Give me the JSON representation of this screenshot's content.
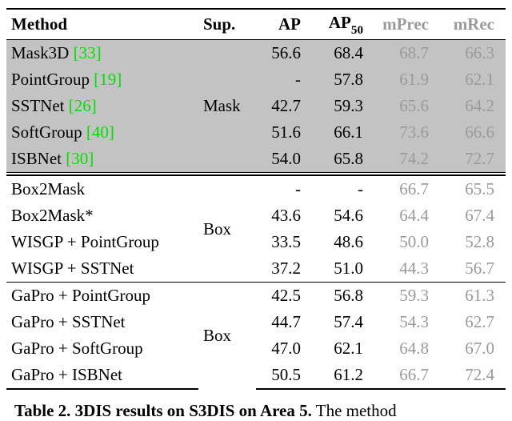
{
  "header": {
    "method": "Method",
    "sup": "Sup.",
    "ap": "AP",
    "ap50_pre": "AP",
    "ap50_sub": "50",
    "mprec": "mPrec",
    "mrec": "mRec"
  },
  "groups": [
    {
      "sup": "Mask",
      "shaded": true,
      "rows": [
        {
          "method": "Mask3D",
          "cite": "[33]",
          "ap": "56.6",
          "ap50": "68.4",
          "mprec": "68.7",
          "mrec": "66.3"
        },
        {
          "method": "PointGroup",
          "cite": "[19]",
          "ap": "-",
          "ap50": "57.8",
          "mprec": "61.9",
          "mrec": "62.1"
        },
        {
          "method": "SSTNet",
          "cite": "[26]",
          "ap": "42.7",
          "ap50": "59.3",
          "mprec": "65.6",
          "mrec": "64.2"
        },
        {
          "method": "SoftGroup",
          "cite": "[40]",
          "ap": "51.6",
          "ap50": "66.1",
          "mprec": "73.6",
          "mrec": "66.6"
        },
        {
          "method": "ISBNet",
          "cite": "[30]",
          "ap": "54.0",
          "ap50": "65.8",
          "mprec": "74.2",
          "mrec": "72.7"
        }
      ]
    },
    {
      "sup": "Box",
      "shaded": false,
      "rows": [
        {
          "method": "Box2Mask",
          "cite": "",
          "ap": "-",
          "ap50": "-",
          "mprec": "66.7",
          "mrec": "65.5"
        },
        {
          "method": "Box2Mask*",
          "cite": "",
          "ap": "43.6",
          "ap50": "54.6",
          "mprec": "64.4",
          "mrec": "67.4"
        },
        {
          "method": "WISGP + PointGroup",
          "cite": "",
          "ap": "33.5",
          "ap50": "48.6",
          "mprec": "50.0",
          "mrec": "52.8"
        },
        {
          "method": "WISGP + SSTNet",
          "cite": "",
          "ap": "37.2",
          "ap50": "51.0",
          "mprec": "44.3",
          "mrec": "56.7"
        }
      ]
    },
    {
      "sup": "Box",
      "shaded": false,
      "rows": [
        {
          "method": "GaPro + PointGroup",
          "cite": "",
          "ap": "42.5",
          "ap50": "56.8",
          "mprec": "59.3",
          "mrec": "61.3"
        },
        {
          "method": "GaPro + SSTNet",
          "cite": "",
          "ap": "44.7",
          "ap50": "57.4",
          "mprec": "54.3",
          "mrec": "62.7"
        },
        {
          "method": "GaPro + SoftGroup",
          "cite": "",
          "ap": "47.0",
          "ap50": "62.1",
          "mprec": "64.8",
          "mrec": "67.0"
        },
        {
          "method": "GaPro + ISBNet",
          "cite": "",
          "ap": "50.5",
          "ap50": "61.2",
          "mprec": "66.7",
          "mrec": "72.4"
        }
      ]
    }
  ],
  "caption": {
    "label_bold": "Table 2. 3DIS results on S3DIS on Area 5.",
    "rest": "  The method"
  },
  "chart_data": {
    "type": "table",
    "title": "3DIS results on S3DIS on Area 5",
    "columns": [
      "Method",
      "Sup.",
      "AP",
      "AP50",
      "mPrec",
      "mRec"
    ],
    "rows": [
      [
        "Mask3D [33]",
        "Mask",
        56.6,
        68.4,
        68.7,
        66.3
      ],
      [
        "PointGroup [19]",
        "Mask",
        null,
        57.8,
        61.9,
        62.1
      ],
      [
        "SSTNet [26]",
        "Mask",
        42.7,
        59.3,
        65.6,
        64.2
      ],
      [
        "SoftGroup [40]",
        "Mask",
        51.6,
        66.1,
        73.6,
        66.6
      ],
      [
        "ISBNet [30]",
        "Mask",
        54.0,
        65.8,
        74.2,
        72.7
      ],
      [
        "Box2Mask",
        "Box",
        null,
        null,
        66.7,
        65.5
      ],
      [
        "Box2Mask*",
        "Box",
        43.6,
        54.6,
        64.4,
        67.4
      ],
      [
        "WISGP + PointGroup",
        "Box",
        33.5,
        48.6,
        50.0,
        52.8
      ],
      [
        "WISGP + SSTNet",
        "Box",
        37.2,
        51.0,
        44.3,
        56.7
      ],
      [
        "GaPro + PointGroup",
        "Box",
        42.5,
        56.8,
        59.3,
        61.3
      ],
      [
        "GaPro + SSTNet",
        "Box",
        44.7,
        57.4,
        54.3,
        62.7
      ],
      [
        "GaPro + SoftGroup",
        "Box",
        47.0,
        62.1,
        64.8,
        67.0
      ],
      [
        "GaPro + ISBNet",
        "Box",
        50.5,
        61.2,
        66.7,
        72.4
      ]
    ]
  }
}
